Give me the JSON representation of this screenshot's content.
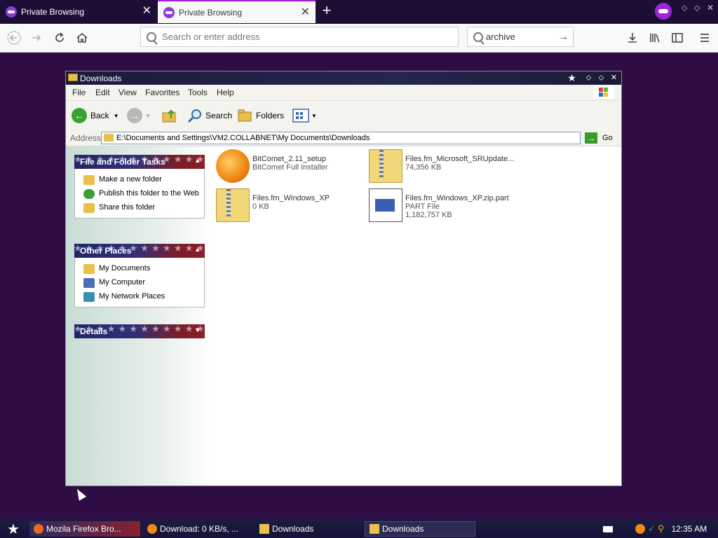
{
  "browser": {
    "tabs": [
      {
        "label": "Private Browsing"
      },
      {
        "label": "Private Browsing"
      }
    ],
    "new_tab_label": "+",
    "close_glyph": "✕",
    "url_placeholder": "Search or enter address",
    "search_value": "archive",
    "nav_icons": [
      "back-arrow-icon",
      "forward-arrow-icon",
      "reload-icon",
      "home-icon"
    ],
    "right_icons": [
      "download-icon",
      "library-icon",
      "sidebar-icon",
      "hamburger-menu-icon"
    ]
  },
  "explorer": {
    "title": "Downloads",
    "menu": [
      "File",
      "Edit",
      "View",
      "Favorites",
      "Tools",
      "Help"
    ],
    "toolbar": {
      "back": "Back",
      "search": "Search",
      "folders": "Folders"
    },
    "address_label": "Address",
    "address_value": "E:\\Documents and Settings\\VM2.COLLABNET\\My Documents\\Downloads",
    "go_label": "Go",
    "panels": {
      "file_tasks": {
        "title": "File and Folder Tasks",
        "items": [
          "Make a new folder",
          "Publish this folder to the Web",
          "Share this folder"
        ]
      },
      "other_places": {
        "title": "Other Places",
        "items": [
          "My Documents",
          "My Computer",
          "My Network Places"
        ]
      },
      "details": {
        "title": "Details"
      }
    },
    "files": [
      {
        "name": "BitComet_2.11_setup",
        "sub": "BitComet Full Installer"
      },
      {
        "name": "Files.fm_Microsoft_SRUpdate...",
        "sub": "74,356 KB"
      },
      {
        "name": "Files.fm_Windows_XP",
        "sub": "0 KB"
      },
      {
        "name": "Files.fm_Windows_XP.zip.part",
        "sub": "PART File",
        "sub2": "1,182,757 KB"
      }
    ]
  },
  "taskbar": {
    "items": [
      "Mozila Firefox Bro...",
      "Download: 0 KB/s, ...",
      "Downloads",
      "Downloads"
    ],
    "clock": "12:35 AM"
  },
  "colors": {
    "desktop": "#2e0c44",
    "tab_strip": "#1d0e36",
    "private_purple": "#9b28d4",
    "panel_header_blue": "#232566",
    "panel_header_red": "#8c1f28"
  }
}
